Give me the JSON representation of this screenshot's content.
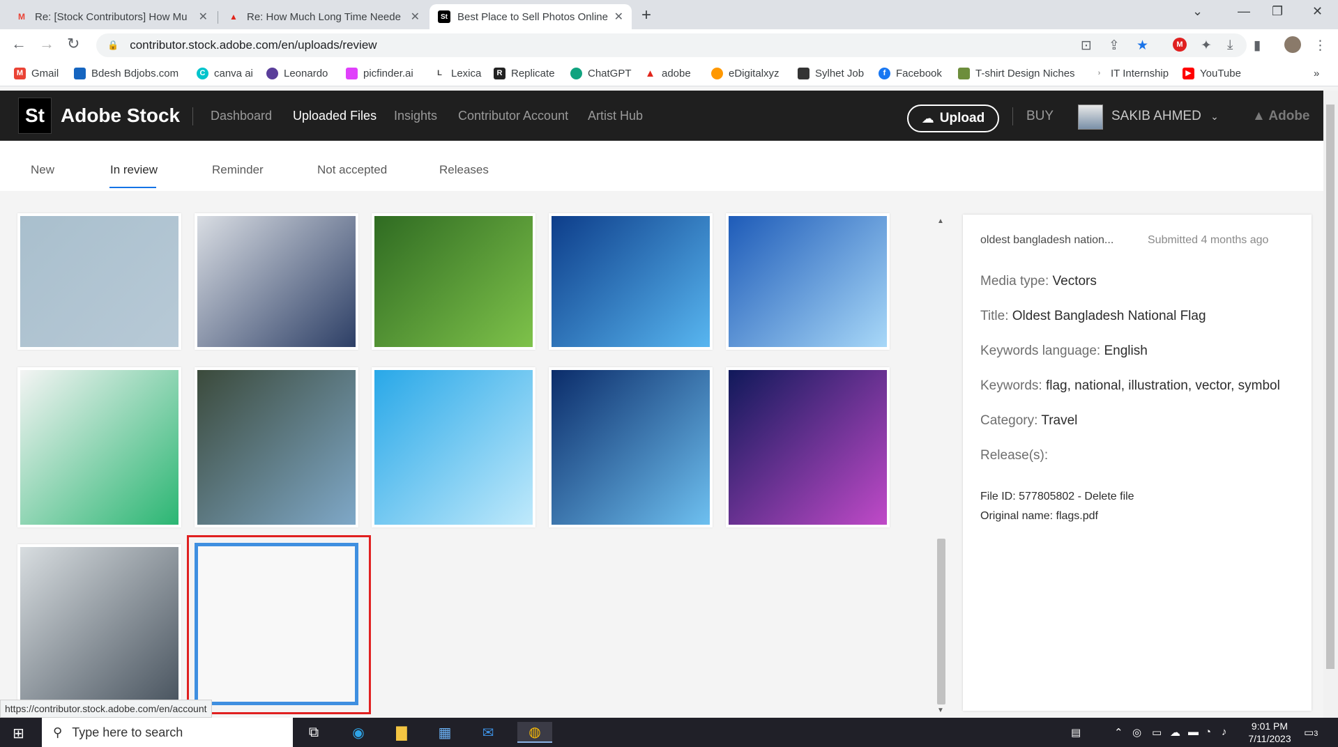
{
  "browser": {
    "tabs": [
      {
        "title": "Re: [Stock Contributors] How Mu",
        "icon": "gmail-icon"
      },
      {
        "title": "Re: How Much Long Time Neede",
        "icon": "adobe-icon"
      },
      {
        "title": "Best Place to Sell Photos Online,",
        "icon": "adobe-stock-icon",
        "active": true
      }
    ],
    "new_tab": "+",
    "url": "contributor.stock.adobe.com/en/uploads/review",
    "bookmarks": [
      {
        "label": "Gmail",
        "color": "#ea4335"
      },
      {
        "label": "Bdesh Bdjobs.com",
        "color": "#1565c0"
      },
      {
        "label": "canva ai",
        "color": "#00c4cc"
      },
      {
        "label": "Leonardo",
        "color": "#5a3e9a"
      },
      {
        "label": "picfinder.ai",
        "color": "#e040fb"
      },
      {
        "label": "Lexica",
        "color": "#444444"
      },
      {
        "label": "Replicate",
        "color": "#222222"
      },
      {
        "label": "ChatGPT",
        "color": "#10a37f"
      },
      {
        "label": "adobe",
        "color": "#e1251b"
      },
      {
        "label": "eDigitalxyz",
        "color": "#ff9800"
      },
      {
        "label": "Sylhet Job",
        "color": "#333333"
      },
      {
        "label": "Facebook",
        "color": "#1877f2"
      },
      {
        "label": "T-shirt Design Niches",
        "color": "#6d8e3c"
      },
      {
        "label": "IT Internship",
        "color": "#999999"
      },
      {
        "label": "YouTube",
        "color": "#ff0000"
      }
    ],
    "bookmarks_more": "»",
    "status_url": "https://contributor.stock.adobe.com/en/account"
  },
  "header": {
    "logo": "St",
    "brand": "Adobe Stock",
    "nav": [
      {
        "label": "Dashboard",
        "active": false
      },
      {
        "label": "Uploaded Files",
        "active": true
      },
      {
        "label": "Insights",
        "active": false
      },
      {
        "label": "Contributor Account",
        "active": false
      },
      {
        "label": "Artist Hub",
        "active": false
      }
    ],
    "upload_label": "Upload",
    "buy_label": "BUY",
    "user_name": "SAKIB AHMED",
    "adobe_label": "Adobe"
  },
  "subtabs": [
    {
      "label": "New"
    },
    {
      "label": "In review",
      "active": true
    },
    {
      "label": "Reminder"
    },
    {
      "label": "Not accepted"
    },
    {
      "label": "Releases"
    }
  ],
  "thumbnails": [
    {
      "name": "thank-you-tshirt",
      "colors": [
        "#a9bfcd",
        "#b7c9d6"
      ]
    },
    {
      "name": "smiling-businessman",
      "colors": [
        "#d9dde3",
        "#2d3f66"
      ]
    },
    {
      "name": "green-lawn-forest",
      "colors": [
        "#2f6b22",
        "#7ec24a"
      ]
    },
    {
      "name": "hand-digital-interface",
      "colors": [
        "#0d3d8a",
        "#58b6f0"
      ]
    },
    {
      "name": "blue-data-chart-hand",
      "colors": [
        "#1e5bb8",
        "#a8d8f8"
      ]
    },
    {
      "name": "smartphones-on-table",
      "colors": [
        "#f4f4f4",
        "#2bb673"
      ]
    },
    {
      "name": "hand-holding-phone",
      "colors": [
        "#3b4a3b",
        "#7fa8c8"
      ]
    },
    {
      "name": "hand-cloud-tablet",
      "colors": [
        "#29a8e8",
        "#bfe9fb"
      ]
    },
    {
      "name": "chart-on-laptop",
      "colors": [
        "#0b2c6a",
        "#6ec0f0"
      ]
    },
    {
      "name": "purple-tech-hand",
      "colors": [
        "#10195a",
        "#c04ac8"
      ]
    },
    {
      "name": "businessman-tablet-window",
      "colors": [
        "#d8dde0",
        "#4a5560"
      ]
    }
  ],
  "details": {
    "name": "oldest bangladesh nation...",
    "submitted": "Submitted 4 months ago",
    "media_type_label": "Media type:",
    "media_type": "Vectors",
    "title_label": "Title:",
    "title": "Oldest Bangladesh National Flag",
    "keywords_language_label": "Keywords language:",
    "keywords_language": "English",
    "keywords_label": "Keywords:",
    "keywords": "flag, national, illustration, vector, symbol",
    "category_label": "Category:",
    "category": "Travel",
    "releases_label": "Release(s):",
    "file_id": "File ID: 577805802 - Delete file",
    "original_name": "Original name: flags.pdf"
  },
  "taskbar": {
    "search_placeholder": "Type here to search",
    "time": "9:01 PM",
    "date": "7/11/2023",
    "notification_count": "3"
  }
}
